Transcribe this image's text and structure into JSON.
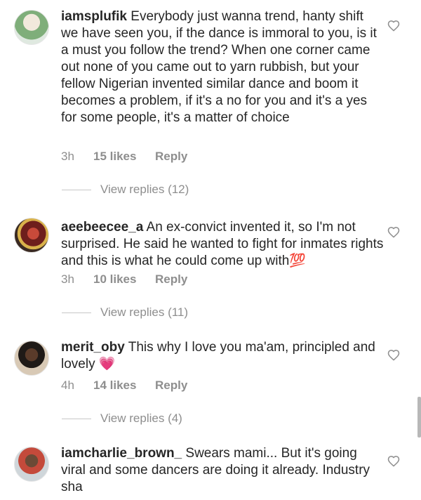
{
  "comments": [
    {
      "username": "iamsplufik",
      "text": "Everybody just wanna trend, hanty shift we have seen you, if the dance is immoral to you, is it a must you follow the trend? When one corner came out none of you came out to yarn rubbish, but your fellow Nigerian invented similar dance and boom it becomes a  problem, if it's a no for you and it's a yes for some people,  it's a matter of choice",
      "time": "3h",
      "likes": "15 likes",
      "reply": "Reply",
      "view_replies": "View replies (12)"
    },
    {
      "username": "aeebeecee_a",
      "text": "An ex-convict invented it, so I'm not surprised. He said he wanted to fight for inmates rights and this is what he could come up with💯",
      "time": "3h",
      "likes": "10 likes",
      "reply": "Reply",
      "view_replies": "View replies (11)"
    },
    {
      "username": "merit_oby",
      "text": "This why I love you ma'am, principled and lovely 💗",
      "time": "4h",
      "likes": "14 likes",
      "reply": "Reply",
      "view_replies": "View replies (4)"
    },
    {
      "username": "iamcharlie_brown_",
      "text": "Swears mami... But it's going viral and some dancers are doing it already. Industry sha"
    }
  ],
  "icons": {
    "like": "heart-outline-icon"
  },
  "colors": {
    "text": "#262626",
    "secondary": "#8e8e8e"
  }
}
